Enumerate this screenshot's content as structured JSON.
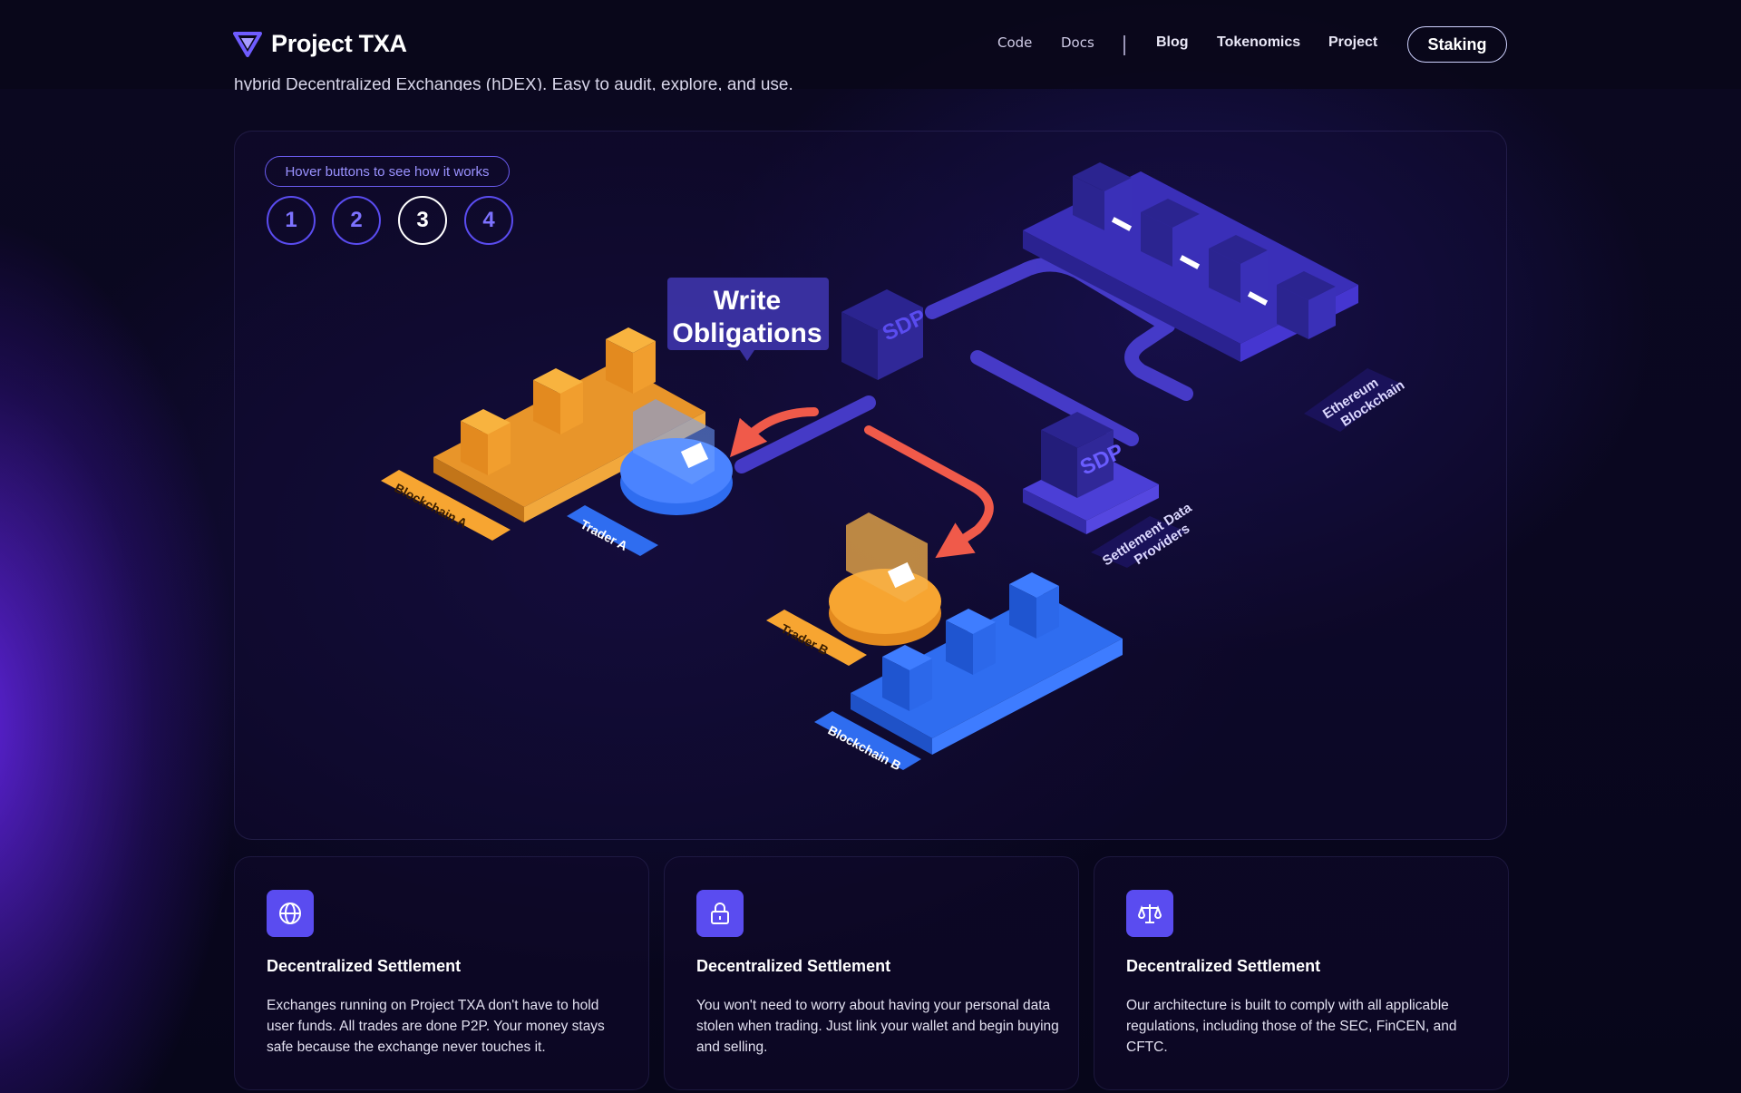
{
  "brand": {
    "name": "Project TXA",
    "accent": "#5a4cf0"
  },
  "nav": {
    "items": [
      {
        "label": "Code"
      },
      {
        "label": "Docs"
      },
      {
        "label": "Blog"
      },
      {
        "label": "Tokenomics"
      },
      {
        "label": "Project"
      }
    ],
    "cta_label": "Staking"
  },
  "intro_text": "hybrid Decentralized Exchanges (hDEX). Easy to audit, explore, and use.",
  "demo": {
    "hint": "Hover buttons to see how it works",
    "steps": [
      "1",
      "2",
      "3",
      "4"
    ],
    "active_step": "3",
    "callout": [
      "Write",
      "Obligations"
    ],
    "labels": {
      "blockchain_a": "Blockchain A",
      "trader_a": "Trader A",
      "trader_b": "Trader B",
      "blockchain_b": "Blockchain B",
      "sdp_line1": "Settlement Data",
      "sdp_line2": "Providers",
      "eth_line1": "Ethereum",
      "eth_line2": "Blockchain",
      "sdp_box": "SDP"
    },
    "colors": {
      "orange": "#f7a531",
      "blue": "#2f6df0",
      "purple": "#5a4cf0",
      "arrow": "#f05a4a"
    }
  },
  "features": [
    {
      "icon": "globe-icon",
      "title": "Decentralized Settlement",
      "text": "Exchanges running on Project TXA don't have to hold user funds. All trades are done P2P. Your money stays safe because the exchange never touches it."
    },
    {
      "icon": "lock-icon",
      "title": "Decentralized Settlement",
      "text": "You won't need to worry about having your personal data stolen when trading. Just link your wallet and begin buying and selling."
    },
    {
      "icon": "scale-icon",
      "title": "Decentralized Settlement",
      "text": "Our architecture is built to comply with all applicable regulations, including those of the SEC, FinCEN, and CFTC."
    }
  ]
}
